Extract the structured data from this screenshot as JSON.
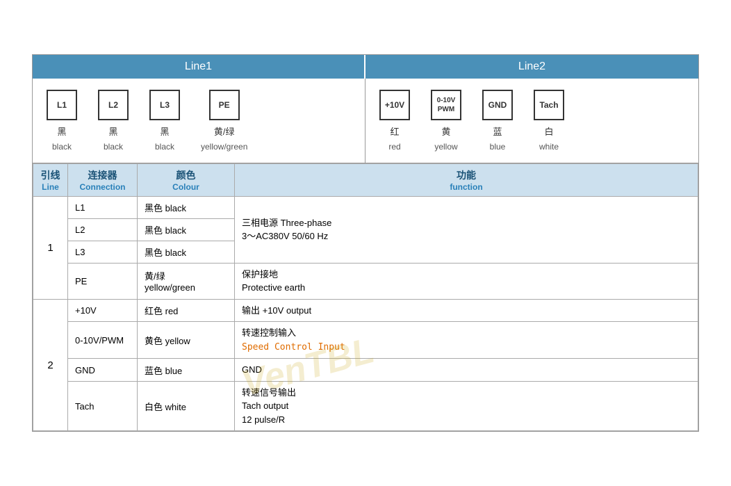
{
  "header": {
    "line1_label": "Line1",
    "line2_label": "Line2"
  },
  "diagram": {
    "line1_connectors": [
      {
        "id": "conn-L1",
        "box_label": "L1",
        "cn": "黑",
        "en": "black"
      },
      {
        "id": "conn-L2",
        "box_label": "L2",
        "cn": "黑",
        "en": "black"
      },
      {
        "id": "conn-L3",
        "box_label": "L3",
        "cn": "黑",
        "en": "black"
      },
      {
        "id": "conn-PE",
        "box_label": "PE",
        "cn": "黄/绿",
        "en": "yellow/green"
      }
    ],
    "line2_connectors": [
      {
        "id": "conn-10V",
        "box_label": "+10V",
        "cn": "红",
        "en": "red"
      },
      {
        "id": "conn-PWM",
        "box_label": "0-10V\nPWM",
        "cn": "黄",
        "en": "yellow",
        "small": true
      },
      {
        "id": "conn-GND",
        "box_label": "GND",
        "cn": "蓝",
        "en": "blue"
      },
      {
        "id": "conn-Tach",
        "box_label": "Tach",
        "cn": "白",
        "en": "white"
      }
    ]
  },
  "table": {
    "headers": {
      "line": {
        "cn": "引线",
        "en": "Line"
      },
      "connection": {
        "cn": "连接器",
        "en": "Connection"
      },
      "colour": {
        "cn": "颜色",
        "en": "Colour"
      },
      "function": {
        "cn": "功能",
        "en": "function"
      }
    },
    "rows_line1": [
      {
        "connection": "L1",
        "colour": "黑色 black",
        "function": "三相电源 Three-phase\n3～AC380V 50/60 Hz",
        "rowspan_func": 3
      },
      {
        "connection": "L2",
        "colour": "黑色 black"
      },
      {
        "connection": "L3",
        "colour": "黑色 black"
      },
      {
        "connection": "PE",
        "colour": "黄/绿\nyellow/green",
        "function": "保护接地\nProtective earth"
      }
    ],
    "rows_line2": [
      {
        "connection": "+10V",
        "colour": "红色 red",
        "function": "输出 +10V output"
      },
      {
        "connection": "0-10V/PWM",
        "colour": "黄色 yellow",
        "function_cn": "转速控制输入",
        "function_en": "Speed Control Input"
      },
      {
        "connection": "GND",
        "colour": "蓝色 blue",
        "function": "GND"
      },
      {
        "connection": "Tach",
        "colour": "白色 white",
        "function": "转速信号输出\nTach output\n12 pulse/R"
      }
    ]
  },
  "watermark": "VenTBL"
}
